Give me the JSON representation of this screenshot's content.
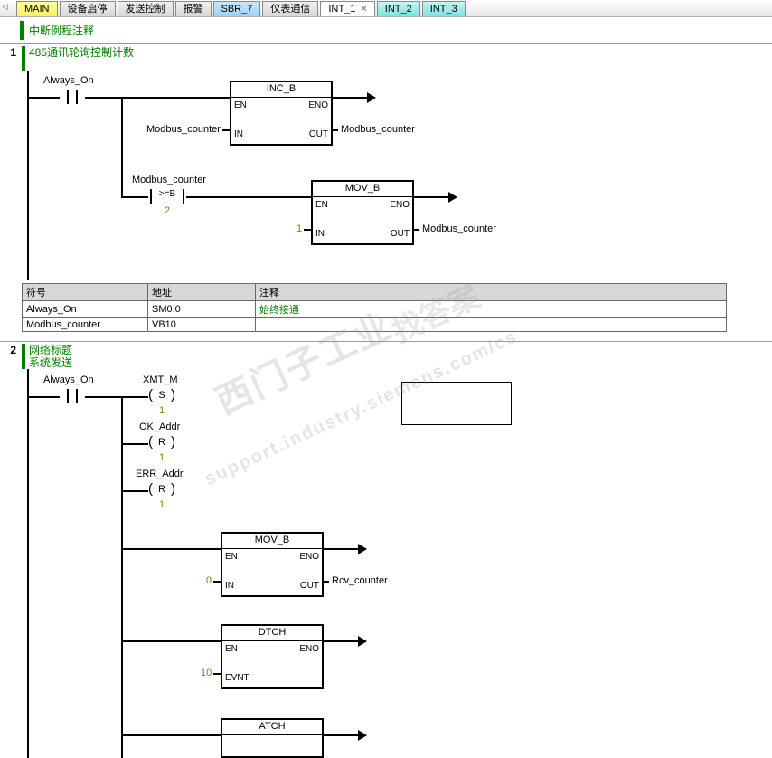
{
  "tabs": [
    {
      "label": "MAIN",
      "cls": "yellow"
    },
    {
      "label": "设备启停",
      "cls": "grey"
    },
    {
      "label": "发送控制",
      "cls": "grey"
    },
    {
      "label": "报警",
      "cls": "grey"
    },
    {
      "label": "SBR_7",
      "cls": "blue"
    },
    {
      "label": "仪表通信",
      "cls": "grey"
    },
    {
      "label": "INT_1",
      "cls": "white",
      "close": "×"
    },
    {
      "label": "INT_2",
      "cls": "cyan"
    },
    {
      "label": "INT_3",
      "cls": "cyan"
    }
  ],
  "nav_arrow": "◁",
  "file_comment": "中断例程注释",
  "net1": {
    "num": "1",
    "title": "485通讯轮询控制计数",
    "always_on": "Always_On",
    "inc_b": {
      "title": "INC_B",
      "en": "EN",
      "eno": "ENO",
      "in": "IN",
      "out": "OUT"
    },
    "mc_in": "Modbus_counter",
    "mc_out": "Modbus_counter",
    "cmp_operand": "Modbus_counter",
    "cmp_op": ">=B",
    "cmp_val": "2",
    "mov_b": {
      "title": "MOV_B",
      "en": "EN",
      "eno": "ENO",
      "in": "IN",
      "out": "OUT"
    },
    "mov_in": "1",
    "mov_out": "Modbus_counter",
    "sym": {
      "h1": "符号",
      "h2": "地址",
      "h3": "注释",
      "r1c1": "Always_On",
      "r1c2": "SM0.0",
      "r1c3": "始终接通",
      "r2c1": "Modbus_counter",
      "r2c2": "VB10",
      "r2c3": ""
    }
  },
  "net2": {
    "num": "2",
    "title_l1": "网络标题",
    "title_l2": "系统发送",
    "always_on": "Always_On",
    "xmt": {
      "label": "XMT_M",
      "inner": "S",
      "cnt": "1"
    },
    "ok": {
      "label": "OK_Addr",
      "inner": "R",
      "cnt": "1"
    },
    "err": {
      "label": "ERR_Addr",
      "inner": "R",
      "cnt": "1"
    },
    "mov_b": {
      "title": "MOV_B",
      "en": "EN",
      "eno": "ENO",
      "in": "IN",
      "out": "OUT"
    },
    "mov_in": "0",
    "mov_out": "Rcv_counter",
    "dtch": {
      "title": "DTCH",
      "en": "EN",
      "eno": "ENO",
      "evnt": "EVNT",
      "evnt_val": "10"
    },
    "atch": {
      "title": "ATCH"
    }
  },
  "watermark1": "西门子工业",
  "watermark2": "找答案",
  "watermark3": "support.industry.siemens.com/cs"
}
